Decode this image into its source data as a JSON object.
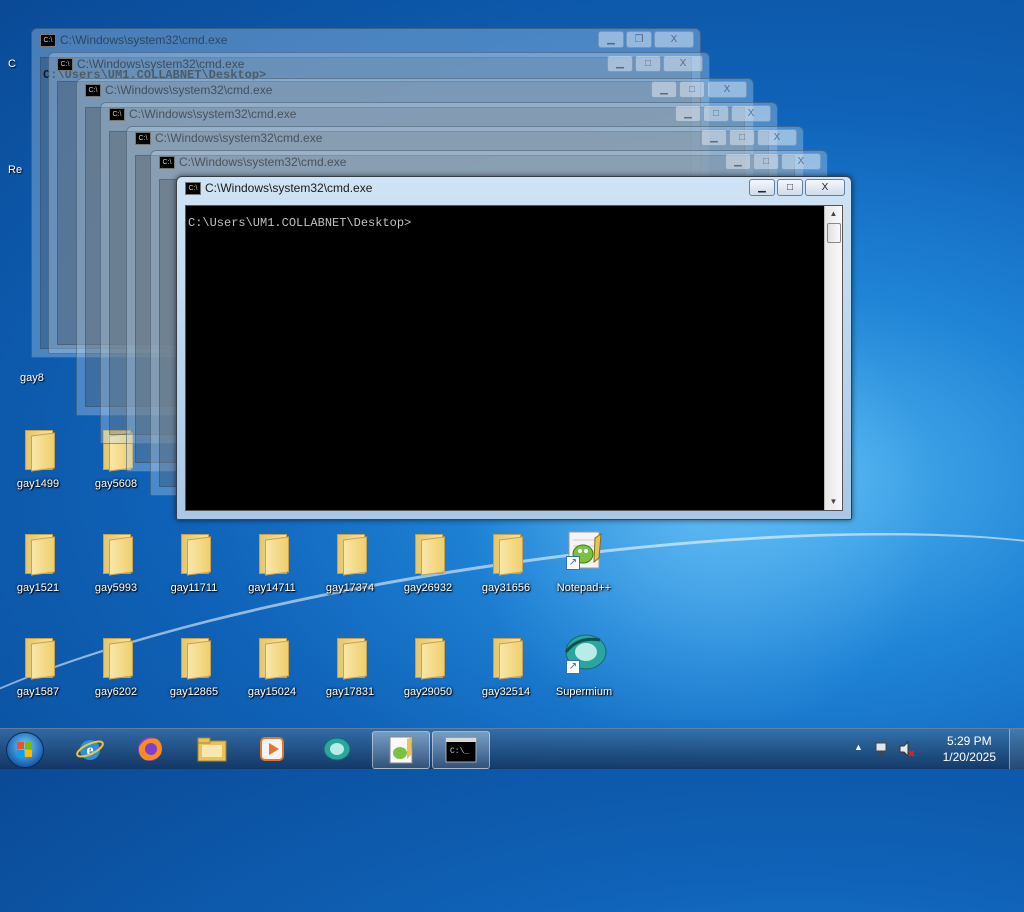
{
  "desktop": {
    "partial_labels": [
      "C",
      "Re",
      "gay8"
    ],
    "row1": [
      "gay1499",
      "gay5608"
    ],
    "row2": [
      "gay1521",
      "gay5993",
      "gay11711",
      "gay14711",
      "gay17374",
      "gay26932",
      "gay31656",
      "Notepad++"
    ],
    "row3": [
      "gay1587",
      "gay6202",
      "gay12865",
      "gay15024",
      "gay17831",
      "gay29050",
      "gay32514",
      "Supermium"
    ]
  },
  "windows": {
    "title": "C:\\Windows\\system32\\cmd.exe",
    "prompt": "C:\\Users\\UM1.COLLABNET\\Desktop>",
    "minimize_glyph": "▁",
    "maximize_glyph": "□",
    "restore_glyph": "❐",
    "close_glyph": "X"
  },
  "taskbar": {
    "clock_time": "5:29 PM",
    "clock_date": "1/20/2025",
    "tray_up_glyph": "▲"
  },
  "colors": {
    "console_bg": "#000000",
    "console_text": "#c0c0c0",
    "taskbar": "#1f3f66",
    "desktop_accent": "#1f83d6"
  }
}
